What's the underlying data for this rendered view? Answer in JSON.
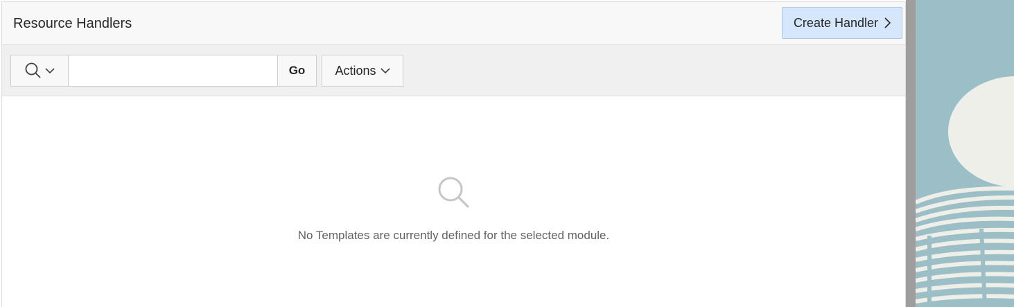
{
  "region": {
    "title": "Resource Handlers",
    "create_button_label": "Create Handler"
  },
  "toolbar": {
    "search_menu_icon": "search-icon",
    "search_value": "",
    "go_label": "Go",
    "actions_label": "Actions"
  },
  "empty_state": {
    "icon": "search-icon",
    "message": "No Templates are currently defined for the selected module."
  },
  "colors": {
    "create_button_bg": "#d6e7fb",
    "side_art_bg": "#9cbfc7",
    "side_art_shape": "#efefe9"
  }
}
